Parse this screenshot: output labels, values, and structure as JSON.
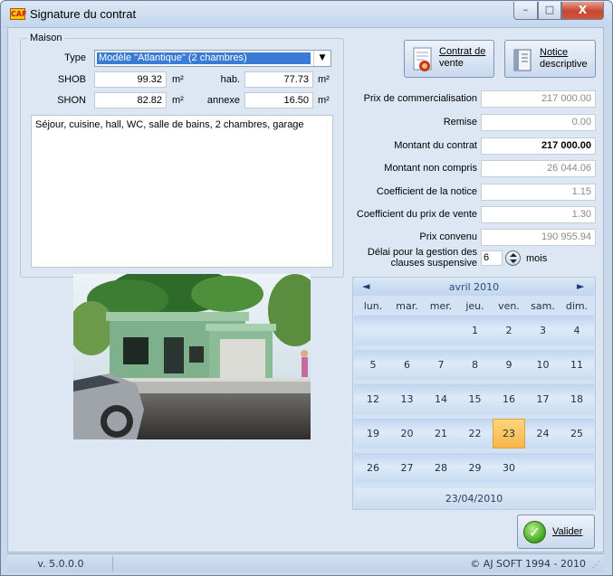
{
  "window": {
    "title": "Signature du contrat",
    "app_icon": "CAF",
    "controls": {
      "minimize": "–",
      "maximize": "□",
      "close": "X"
    }
  },
  "maison": {
    "group_title": "Maison",
    "type_label": "Type",
    "type_value": "Modèle \"Atlantique\" (2 chambres)",
    "shob_label": "SHOB",
    "shob_value": "99.32",
    "hab_label": "hab.",
    "hab_value": "77.73",
    "shon_label": "SHON",
    "shon_value": "82.82",
    "annexe_label": "annexe",
    "annexe_value": "16.50",
    "unit": "m²",
    "description": "Séjour, cuisine, hall, WC, salle de bains, 2 chambres, garage"
  },
  "buttons": {
    "contrat_line1": "Contrat de",
    "contrat_line2": "vente",
    "notice_line1": "Notice",
    "notice_line2": "descriptive",
    "valider": "Valider"
  },
  "prices": {
    "prix_commercialisation_label": "Prix de commercialisation",
    "prix_commercialisation_value": "217 000.00",
    "remise_label": "Remise",
    "remise_value": "0.00",
    "montant_contrat_label": "Montant du contrat",
    "montant_contrat_value": "217 000.00",
    "montant_non_compris_label": "Montant non compris",
    "montant_non_compris_value": "26 044.06",
    "coef_notice_label": "Coefficient de la notice",
    "coef_notice_value": "1.15",
    "coef_prix_vente_label": "Coefficient du prix de vente",
    "coef_prix_vente_value": "1.30",
    "prix_convenu_label": "Prix convenu",
    "prix_convenu_value": "190 955.94",
    "delai_label_line1": "Délai pour la gestion des",
    "delai_label_line2": "clauses suspensive",
    "delai_value": "6",
    "delai_unit": "mois"
  },
  "calendar": {
    "month": "avril 2010",
    "prev": "◄",
    "next": "►",
    "weekdays": [
      "lun.",
      "mar.",
      "mer.",
      "jeu.",
      "ven.",
      "sam.",
      "dim."
    ],
    "weeks": [
      [
        "",
        "",
        "",
        "1",
        "2",
        "3",
        "4"
      ],
      [
        "5",
        "6",
        "7",
        "8",
        "9",
        "10",
        "11"
      ],
      [
        "12",
        "13",
        "14",
        "15",
        "16",
        "17",
        "18"
      ],
      [
        "19",
        "20",
        "21",
        "22",
        "23",
        "24",
        "25"
      ],
      [
        "26",
        "27",
        "28",
        "29",
        "30",
        "",
        ""
      ]
    ],
    "selected_day": "23",
    "selected_date": "23/04/2010"
  },
  "status": {
    "version": "v. 5.0.0.0",
    "copyright": "© AJ SOFT 1994 - 2010"
  },
  "colors": {
    "accent": "#3a7bd5",
    "selected_day": "#f7b748",
    "validate_green": "#3da51e"
  }
}
